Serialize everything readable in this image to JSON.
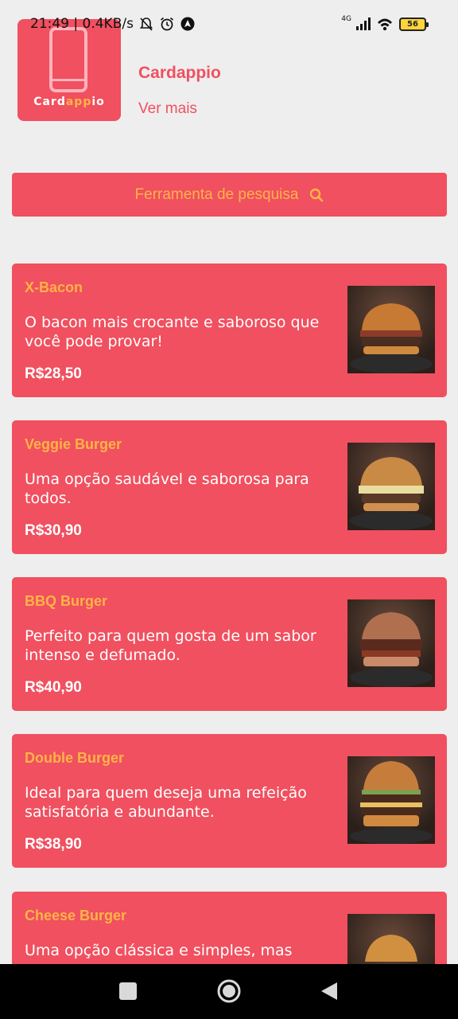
{
  "status_bar": {
    "time_speed": "21:49 | 0.4KB/s",
    "network_label": "4G",
    "battery_level": "56"
  },
  "header": {
    "logo_text_part1": "Card",
    "logo_text_part2": "app",
    "logo_text_part3": "io",
    "app_name": "Cardappio",
    "see_more": "Ver mais"
  },
  "search": {
    "label": "Ferramenta de pesquisa"
  },
  "menu": [
    {
      "name": "X-Bacon",
      "description": "O bacon mais crocante e saboroso que você pode provar!",
      "price": "R$28,50"
    },
    {
      "name": "Veggie Burger",
      "description": "Uma opção saudável e saborosa para todos.",
      "price": "R$30,90"
    },
    {
      "name": "BBQ Burger",
      "description": "Perfeito para quem gosta de um sabor intenso e defumado.",
      "price": "R$40,90"
    },
    {
      "name": "Double Burger",
      "description": "Ideal para quem deseja uma refeição satisfatória e abundante.",
      "price": "R$38,90"
    },
    {
      "name": "Cheese Burger",
      "description": "Uma opção clássica e simples, mas",
      "price": ""
    }
  ],
  "colors": {
    "primary": "#f0505f",
    "accent": "#ffb347",
    "background": "#eeeeee"
  }
}
